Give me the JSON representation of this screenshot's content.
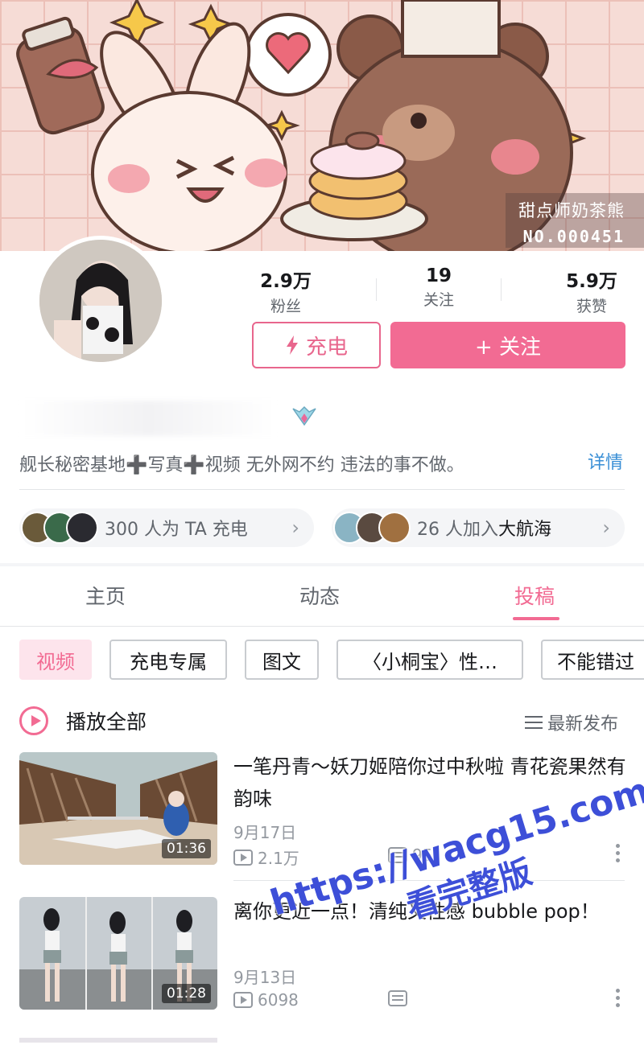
{
  "banner": {
    "name": "甜点师奶茶熊",
    "number": "NO.000451"
  },
  "stats": [
    {
      "value": "2.9万",
      "label": "粉丝"
    },
    {
      "value": "19",
      "label": "关注"
    },
    {
      "value": "5.9万",
      "label": "获赞"
    }
  ],
  "actions": {
    "charge": "充电",
    "follow": "+ 关注"
  },
  "bio": {
    "text": "舰长秘密基地➕写真➕视频 无外网不约 违法的事不做。",
    "more": "详情"
  },
  "supporters": [
    {
      "text_prefix": "300 人为 TA 充电",
      "highlight": ""
    },
    {
      "text_prefix": "26 人加入",
      "highlight": "大航海"
    }
  ],
  "tabs": [
    {
      "label": "主页",
      "active": false
    },
    {
      "label": "动态",
      "active": false
    },
    {
      "label": "投稿",
      "active": true
    }
  ],
  "chips": [
    "视频",
    "充电专属",
    "图文",
    "〈小桐宝〉性…",
    "不能错过"
  ],
  "play_all": {
    "label": "播放全部",
    "sort": "最新发布"
  },
  "videos": [
    {
      "title": "一笔丹青～妖刀姬陪你过中秋啦 青花瓷果然有韵味",
      "date": "9月17日",
      "duration": "01:36",
      "plays": "2.1万",
      "danmaku": "95"
    },
    {
      "title": "离你更近一点！清纯又性感 bubble pop！",
      "date": "9月13日",
      "duration": "01:28",
      "plays": "6098",
      "danmaku": ""
    }
  ],
  "watermark": {
    "line1": "https://wacg15.com",
    "line2": "看完整版"
  },
  "colors": {
    "accent": "#f26b93",
    "link": "#3a8fd6"
  }
}
